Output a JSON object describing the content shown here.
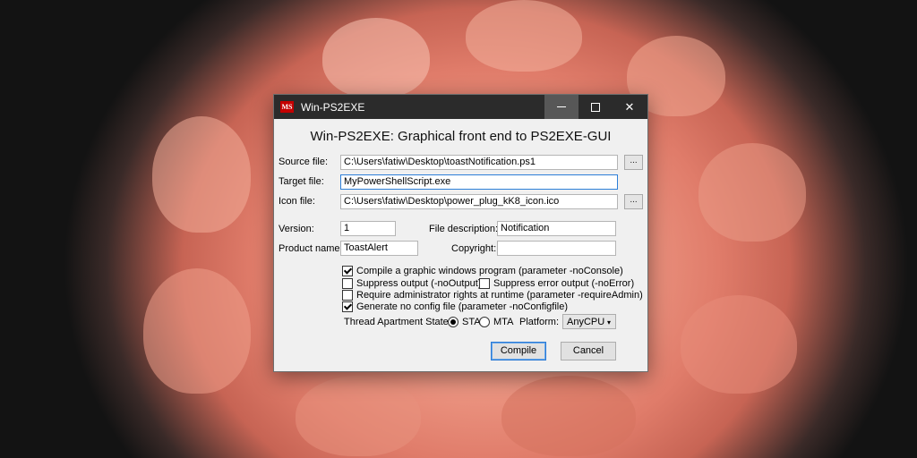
{
  "window": {
    "icon_text": "MS",
    "title": "Win-PS2EXE",
    "heading": "Win-PS2EXE: Graphical front end to PS2EXE-GUI"
  },
  "form": {
    "source_label": "Source file:",
    "source_value": "C:\\Users\\fatiw\\Desktop\\toastNotification.ps1",
    "target_label": "Target file:",
    "target_value": "MyPowerShellScript.exe",
    "icon_label": "Icon file:",
    "icon_value": "C:\\Users\\fatiw\\Desktop\\power_plug_kK8_icon.ico",
    "browse_label": "...",
    "version_label": "Version:",
    "version_value": "1",
    "description_label": "File description:",
    "description_value": "Notification",
    "product_label": "Product name:",
    "product_value": "ToastAlert",
    "copyright_label": "Copyright:",
    "copyright_value": ""
  },
  "options": {
    "no_console": {
      "label": "Compile a graphic windows program (parameter -noConsole)",
      "checked": true
    },
    "no_output": {
      "label": "Suppress output (-noOutput)",
      "checked": false
    },
    "no_error": {
      "label": "Suppress error output (-noError)",
      "checked": false
    },
    "require_admin": {
      "label": "Require administrator rights at runtime (parameter -requireAdmin)",
      "checked": false
    },
    "no_configfile": {
      "label": "Generate no config file (parameter -noConfigfile)",
      "checked": true
    }
  },
  "threading": {
    "label": "Thread Apartment State:",
    "sta_label": "STA",
    "mta_label": "MTA",
    "selected": "STA",
    "platform_label": "Platform:",
    "platform_value": "AnyCPU"
  },
  "buttons": {
    "compile": "Compile",
    "cancel": "Cancel"
  }
}
